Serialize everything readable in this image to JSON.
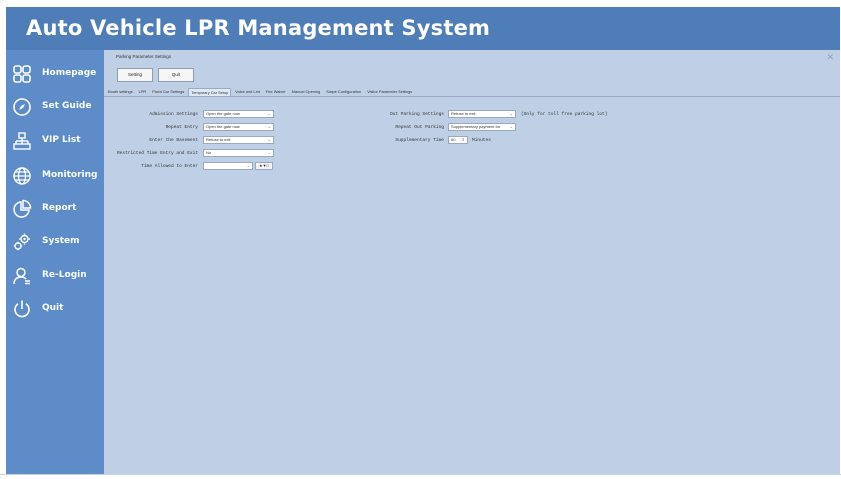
{
  "app": {
    "title": "Auto Vehicle LPR Management System"
  },
  "sidebar": {
    "items": [
      {
        "label": "Homepage",
        "icon": "grid-icon"
      },
      {
        "label": "Set Guide",
        "icon": "compass-icon"
      },
      {
        "label": "VIP List",
        "icon": "org-chart-icon"
      },
      {
        "label": "Monitoring",
        "icon": "globe-icon"
      },
      {
        "label": "Report",
        "icon": "pie-chart-icon"
      },
      {
        "label": "System",
        "icon": "gears-icon"
      },
      {
        "label": "Re-Login",
        "icon": "user-icon"
      },
      {
        "label": "Quit",
        "icon": "power-icon"
      }
    ]
  },
  "panel": {
    "title": "Parking Parameter Settings",
    "close": "✕",
    "buttons": {
      "setting": "Setting",
      "quit": "Quit"
    }
  },
  "tabs": [
    {
      "label": "Booth settings",
      "active": false
    },
    {
      "label": "LPR",
      "active": false
    },
    {
      "label": "Fixed Car Settings",
      "active": false
    },
    {
      "label": "Temporary Car Setup",
      "active": true
    },
    {
      "label": "Voice and Led",
      "active": false
    },
    {
      "label": "Fee Waiver",
      "active": false
    },
    {
      "label": "Manual Opening",
      "active": false
    },
    {
      "label": "Swipe Configuration",
      "active": false
    },
    {
      "label": "Visitor Parameter Settings",
      "active": false
    }
  ],
  "form": {
    "admission_label": "Admission Settings",
    "admission_value": "Open the gate now",
    "repeat_entry_label": "Repeat Entry",
    "repeat_entry_value": "Open the gate now",
    "enter_basement_label": "Enter the Basement",
    "enter_basement_value": "Refuse to exit",
    "restricted_label": "Restricted Time Entry and Exit",
    "restricted_value": "No",
    "time_allowed_label": "Time Allowed to Enter",
    "time_allowed_value": "",
    "time_allowed_button": "★▼□",
    "out_parking_label": "Out Parking Settings",
    "out_parking_value": "Refuse to exit",
    "out_parking_note": "(Only for toll free parking lot)",
    "repeat_out_label": "Repeat Out Parking",
    "repeat_out_value": "Supplementary payment for",
    "supp_time_label": "Supplementary Time",
    "supp_time_value": "60",
    "supp_time_unit": "Minutes"
  },
  "colors": {
    "titlebar": "#4e7db8",
    "sidebar": "#5d8cc8",
    "content": "#bfd0e6"
  }
}
